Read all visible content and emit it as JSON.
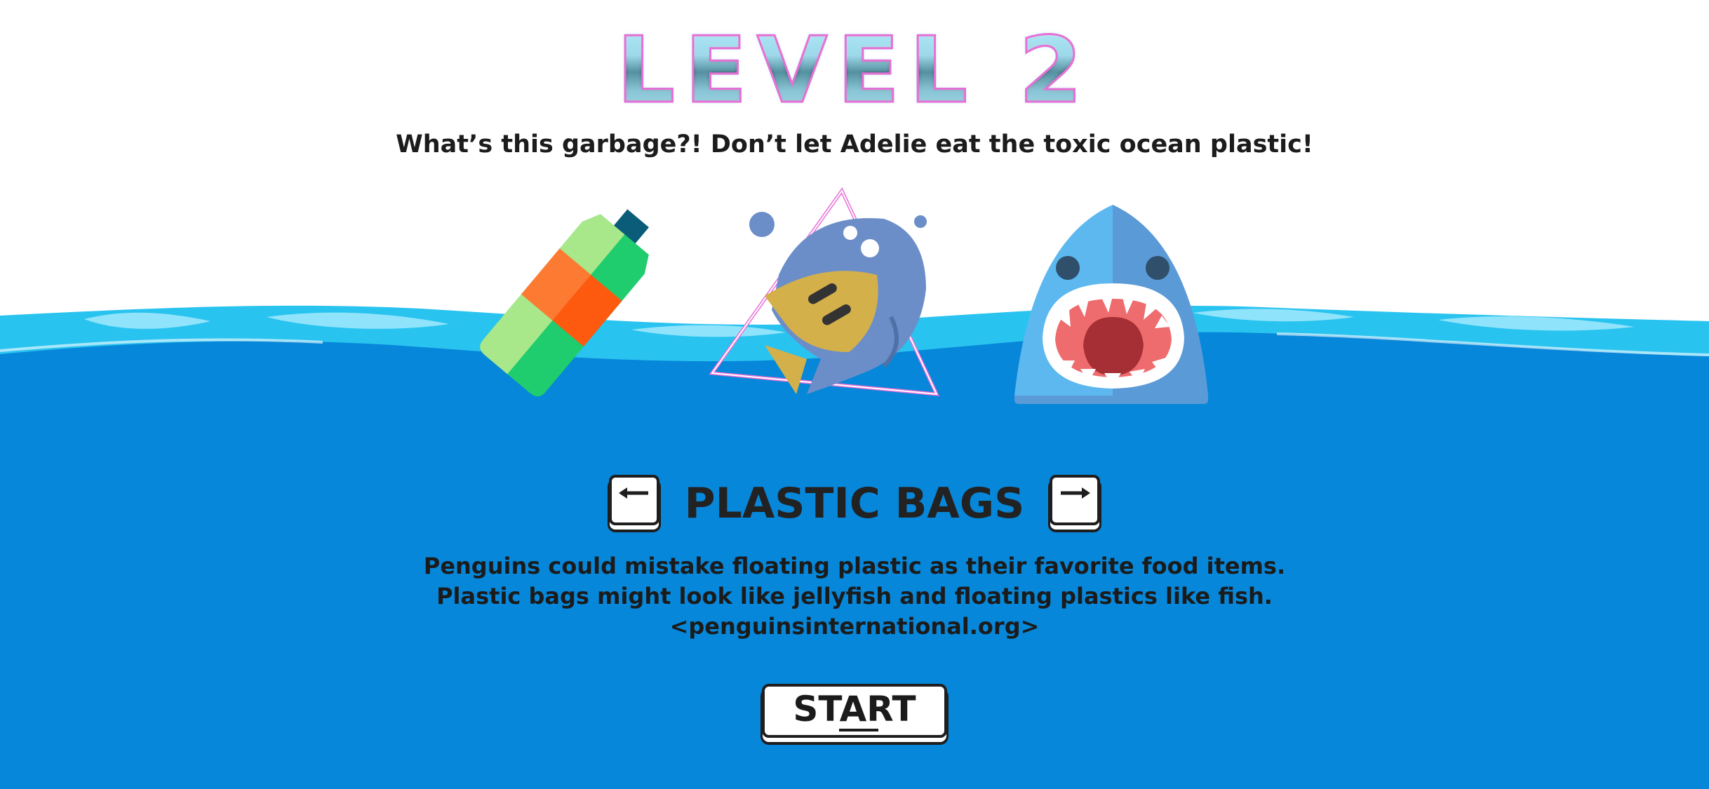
{
  "level": {
    "title": "LEVEL 2"
  },
  "subtitle": "What’s this garbage?! Don’t let Adelie eat the toxic ocean plastic!",
  "selector": {
    "item_name": "PLASTIC BAGS",
    "prev_icon": "left-arrow-key-icon",
    "next_icon": "right-arrow-key-icon"
  },
  "description": {
    "line1": "Penguins could mistake floating plastic as their favorite food items.",
    "line2": "Plastic bags might look like jellyfish and floating plastics like fish.",
    "source": "<penguinsinternational.org>"
  },
  "start_button": {
    "label": "START"
  },
  "icons": [
    "plastic-bottle-icon",
    "fish-icon",
    "shark-icon",
    "ocean-wave-icon"
  ],
  "colors": {
    "ocean": "#0787d9",
    "wave_light": "#29c3f0",
    "bottle_light_green": "#a8e88a",
    "bottle_green": "#1fcd6e",
    "bottle_orange": "#fd7a32",
    "bottle_cap": "#0a5c78",
    "fish_blue": "#6b8ec8",
    "fish_yellow": "#d4b04a",
    "shark_light": "#5cb8ef",
    "shark_dark": "#5a9ad6",
    "neon_pink": "#e86fd6"
  }
}
